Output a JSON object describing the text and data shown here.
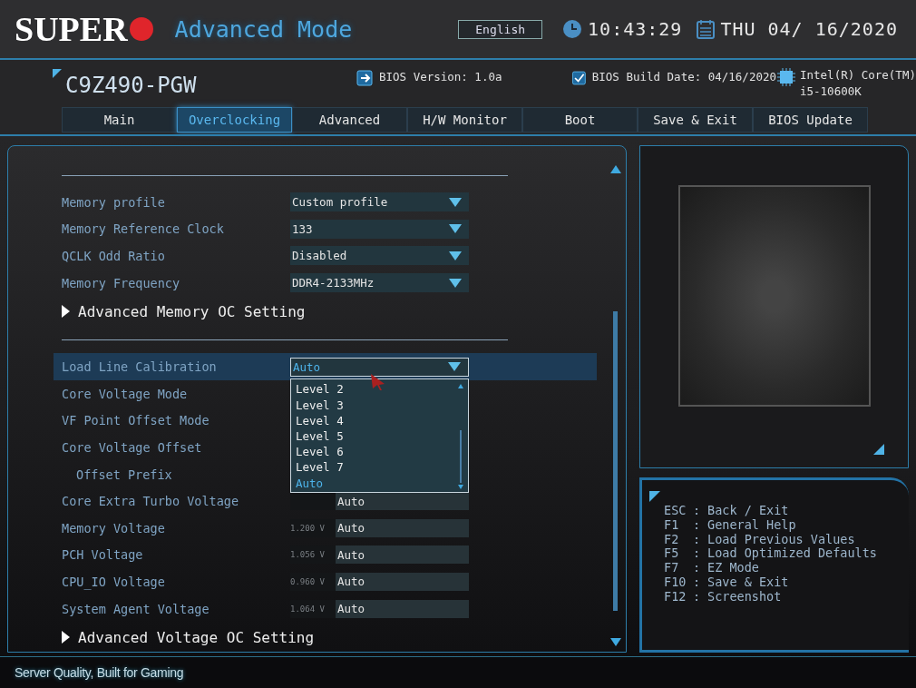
{
  "header": {
    "brand": "SUPER",
    "title": "Advanced Mode",
    "language": "English",
    "time": "10:43:29",
    "date": "THU 04/ 16/2020"
  },
  "info": {
    "model": "C9Z490-PGW",
    "bios_version": "BIOS Version: 1.0a",
    "build_date": "BIOS Build Date: 04/16/2020",
    "cpu_line1": "Intel(R) Core(TM)",
    "cpu_line2": "i5-10600K"
  },
  "tabs": [
    {
      "label": "Main",
      "selected": false
    },
    {
      "label": "Overclocking",
      "selected": true
    },
    {
      "label": "Advanced",
      "selected": false
    },
    {
      "label": "H/W Monitor",
      "selected": false
    },
    {
      "label": "Boot",
      "selected": false
    },
    {
      "label": "Save & Exit",
      "selected": false
    },
    {
      "label": "BIOS Update",
      "selected": false
    }
  ],
  "settings": [
    {
      "kind": "divider"
    },
    {
      "kind": "dropdown",
      "label": "Memory profile",
      "value": "Custom profile",
      "selected": false
    },
    {
      "kind": "dropdown",
      "label": "Memory Reference Clock",
      "value": "133",
      "selected": false
    },
    {
      "kind": "dropdown",
      "label": "QCLK Odd Ratio",
      "value": "Disabled",
      "selected": false
    },
    {
      "kind": "dropdown",
      "label": "Memory Frequency",
      "value": "DDR4-2133MHz",
      "selected": false
    },
    {
      "kind": "submenu",
      "label": "Advanced Memory OC Setting"
    },
    {
      "kind": "divider"
    },
    {
      "kind": "dropdown",
      "label": "Load Line Calibration",
      "value": "Auto",
      "selected": true,
      "open": true
    },
    {
      "kind": "label",
      "label": "Core Voltage Mode",
      "selected": false
    },
    {
      "kind": "label",
      "label": "VF Point Offset Mode",
      "selected": false
    },
    {
      "kind": "label",
      "label": "Core Voltage Offset",
      "selected": false,
      "children": [
        {
          "kind": "label",
          "label": "Offset Prefix",
          "selected": false
        }
      ]
    },
    {
      "kind": "voltage",
      "label": "Core Extra Turbo Voltage",
      "value": "Auto",
      "selected": false
    },
    {
      "kind": "voltage",
      "label": "Memory Voltage",
      "reading": "1.200 V",
      "value": "Auto",
      "selected": false
    },
    {
      "kind": "voltage",
      "label": "PCH Voltage",
      "reading": "1.056 V",
      "value": "Auto",
      "selected": false
    },
    {
      "kind": "voltage",
      "label": "CPU_IO Voltage",
      "reading": "0.960 V",
      "value": "Auto",
      "selected": false
    },
    {
      "kind": "voltage",
      "label": "System Agent Voltage",
      "reading": "1.064 V",
      "value": "Auto",
      "selected": false
    },
    {
      "kind": "submenu",
      "label": "Advanced Voltage OC Setting"
    }
  ],
  "dropdown_options": [
    {
      "label": "Level 2",
      "selected": false
    },
    {
      "label": "Level 3",
      "selected": false
    },
    {
      "label": "Level 4",
      "selected": false
    },
    {
      "label": "Level 5",
      "selected": false
    },
    {
      "label": "Level 6",
      "selected": false
    },
    {
      "label": "Level 7",
      "selected": false
    },
    {
      "label": "Auto",
      "selected": true
    }
  ],
  "help": [
    {
      "key": "ESC",
      "separator": ":",
      "action": "Back / Exit"
    },
    {
      "key": "F1",
      "separator": ":",
      "action": "General Help"
    },
    {
      "key": "F2",
      "separator": ":",
      "action": "Load Previous Values"
    },
    {
      "key": "F5",
      "separator": ":",
      "action": "Load Optimized Defaults"
    },
    {
      "key": "F7",
      "separator": ":",
      "action": "EZ Mode"
    },
    {
      "key": "F10",
      "separator": ":",
      "action": "Save & Exit"
    },
    {
      "key": "F12",
      "separator": ":",
      "action": "Screenshot"
    }
  ],
  "footer": {
    "slogan": "Server Quality, Built for Gaming"
  }
}
